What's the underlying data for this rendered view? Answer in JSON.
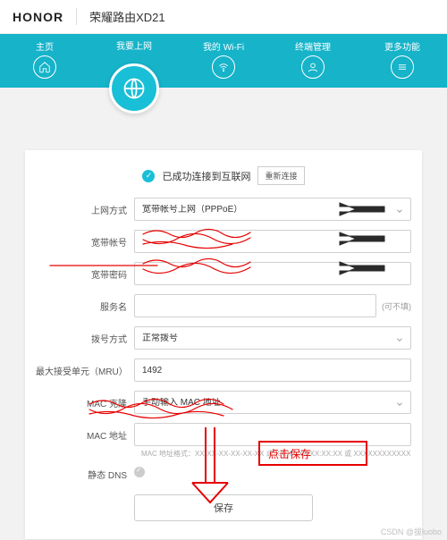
{
  "header": {
    "brand": "HONOR",
    "product": "荣耀路由XD21"
  },
  "nav": {
    "items": [
      {
        "label": "主页",
        "icon": "home-icon"
      },
      {
        "label": "我要上网",
        "icon": "globe-icon",
        "active": true
      },
      {
        "label": "我的 Wi-Fi",
        "icon": "wifi-icon"
      },
      {
        "label": "终端管理",
        "icon": "user-icon"
      },
      {
        "label": "更多功能",
        "icon": "menu-icon"
      }
    ]
  },
  "status": {
    "text": "已成功连接到互联网",
    "reconnect": "重新连接"
  },
  "form": {
    "mode": {
      "label": "上网方式",
      "value": "宽带帐号上网（PPPoE）"
    },
    "account": {
      "label": "宽带帐号",
      "value": ""
    },
    "password": {
      "label": "宽带密码",
      "value": ""
    },
    "service": {
      "label": "服务名",
      "value": "",
      "hint": "(可不填)"
    },
    "dial": {
      "label": "拨号方式",
      "value": "正常拨号"
    },
    "mru": {
      "label": "最大接受单元（MRU）",
      "value": "1492"
    },
    "macclone": {
      "label": "MAC 克隆",
      "value": "手动输入 MAC 地址"
    },
    "mac": {
      "label": "MAC 地址",
      "value": ""
    },
    "machint": "MAC 地址格式：XX-XX-XX-XX-XX-XX\n或 XX:XX:XX:XX:XX:XX 或 XXXXXXXXXXXX",
    "dns": {
      "label": "静态 DNS"
    },
    "save": "保存"
  },
  "annotation": {
    "save_hint": "点击保存"
  },
  "watermark": "CSDN @拔luobo"
}
